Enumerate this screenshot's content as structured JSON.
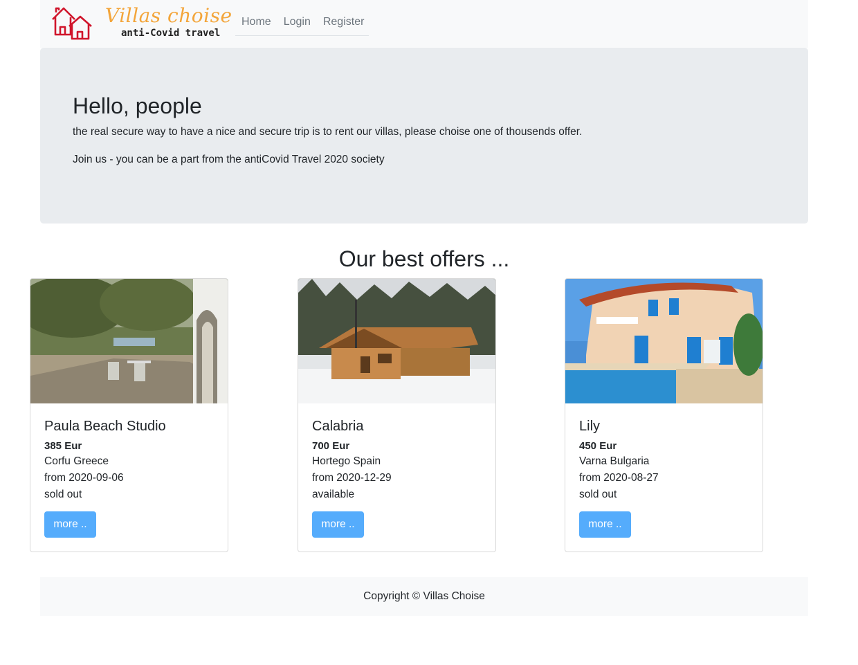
{
  "brand": {
    "title": "Villas choise",
    "subtitle": "anti-Covid travel",
    "icon": "houses-icon"
  },
  "nav": {
    "items": [
      {
        "label": "Home"
      },
      {
        "label": "Login"
      },
      {
        "label": "Register"
      }
    ]
  },
  "hero": {
    "heading": "Hello, people",
    "line1": "the real secure way to have a nice and secure trip is to rent our villas, please choise one of thousends offer.",
    "line2": "Join us - you can be a part from the antiCovid Travel 2020 society"
  },
  "offers": {
    "title": "Our best offers ...",
    "cards": [
      {
        "name": "Paula Beach Studio",
        "price": "385 Eur",
        "location": "Corfu Greece",
        "date": "from 2020-09-06",
        "status": "sold out",
        "button": "more .."
      },
      {
        "name": "Calabria",
        "price": "700 Eur",
        "location": "Hortego Spain",
        "date": "from 2020-12-29",
        "status": "available",
        "button": "more .."
      },
      {
        "name": "Lily",
        "price": "450 Eur",
        "location": "Varna Bulgaria",
        "date": "from 2020-08-27",
        "status": "sold out",
        "button": "more .."
      }
    ]
  },
  "footer": {
    "text": "Copyright © Villas Choise"
  },
  "colors": {
    "accent_button": "#55acfc",
    "logo_orange": "#f3a53a",
    "logo_red": "#d0152b",
    "hero_bg": "#e9ecef",
    "nav_bg": "#f8f9fa"
  }
}
